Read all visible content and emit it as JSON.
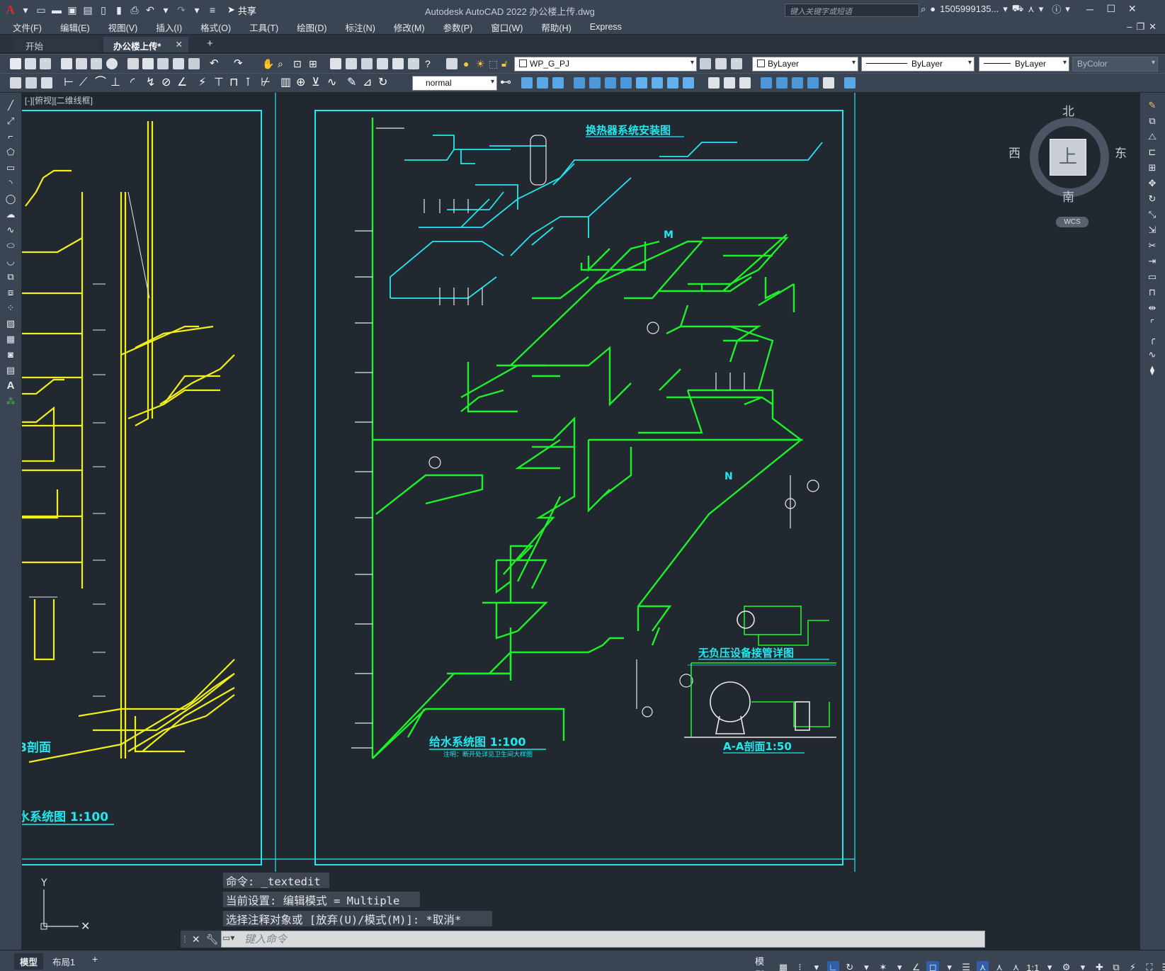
{
  "app": {
    "logo": "A",
    "window_title": "Autodesk AutoCAD 2022    办公楼上传.dwg",
    "share_label": "共享",
    "search_placeholder": "键入关键字或短语",
    "user": "1505999135..."
  },
  "menu": [
    "文件(F)",
    "编辑(E)",
    "视图(V)",
    "插入(I)",
    "格式(O)",
    "工具(T)",
    "绘图(D)",
    "标注(N)",
    "修改(M)",
    "参数(P)",
    "窗口(W)",
    "帮助(H)",
    "Express"
  ],
  "tabs": {
    "start": "开始",
    "active": "办公楼上传*",
    "close": "✕",
    "add": "+"
  },
  "toolbar": {
    "layer": "WP_G_PJ",
    "color": "ByLayer",
    "linetype": "ByLayer",
    "lineweight": "ByLayer",
    "plotstyle": "ByColor",
    "textstyle": "normal"
  },
  "viewport": {
    "label": "[-][俯视][二维线框]"
  },
  "viewcube": {
    "north": "北",
    "south": "南",
    "east": "东",
    "west": "西",
    "top": "上",
    "wcs": "WCS"
  },
  "drawing": {
    "left_title": "水系统图 1:100",
    "left_section": "B剖面",
    "main_title": "给水系统图 1:100",
    "main_note": "注明：断开处详见卫生间大样图",
    "hx_title": "换热器系统安装图",
    "device_title": "无负压设备接管详图",
    "section_title": "A-A剖面1:50",
    "north_mark": "N",
    "m_mark": "M"
  },
  "command": {
    "history": [
      "命令: _textedit",
      "当前设置: 编辑模式 = Multiple",
      "选择注释对象或 [放弃(U)/模式(M)]: *取消*"
    ],
    "placeholder": "键入命令"
  },
  "layouts": {
    "model": "模型",
    "layout1": "布局1",
    "add": "+"
  },
  "status": {
    "model": "模型",
    "scale": "1:1"
  },
  "colors": {
    "cyan": "#22e8ee",
    "green": "#1ef02a",
    "yellow": "#f0f018",
    "white": "#e8e8e8",
    "bg": "#212830"
  }
}
